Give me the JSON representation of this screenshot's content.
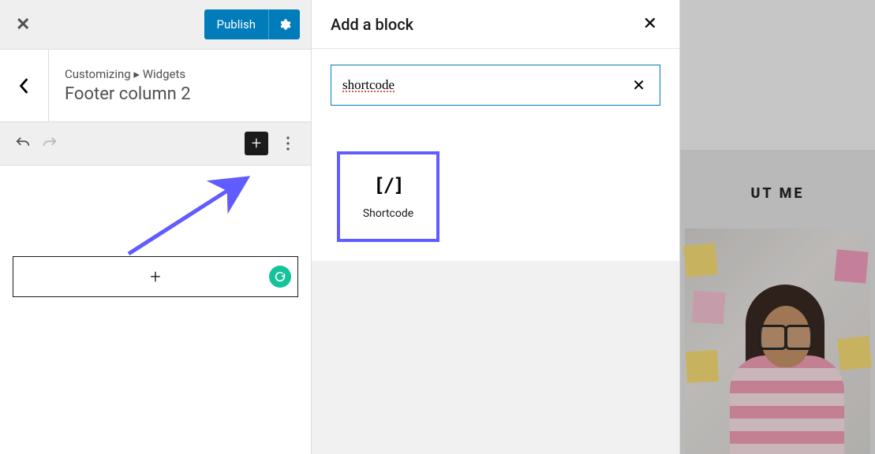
{
  "top": {
    "publish_label": "Publish"
  },
  "breadcrumb": {
    "parent": "Customizing",
    "separator": "▸",
    "section": "Widgets",
    "title": "Footer column 2"
  },
  "block_panel": {
    "title": "Add a block",
    "search_value": "shortcode",
    "result": {
      "icon_text": "[/]",
      "label": "Shortcode"
    }
  },
  "preview": {
    "heading_partial": "UT ME"
  },
  "icons": {
    "close": "✕",
    "chevron_left": "‹",
    "plus": "+",
    "more_dots": "⋮",
    "undo": "↶",
    "redo": "↷"
  }
}
